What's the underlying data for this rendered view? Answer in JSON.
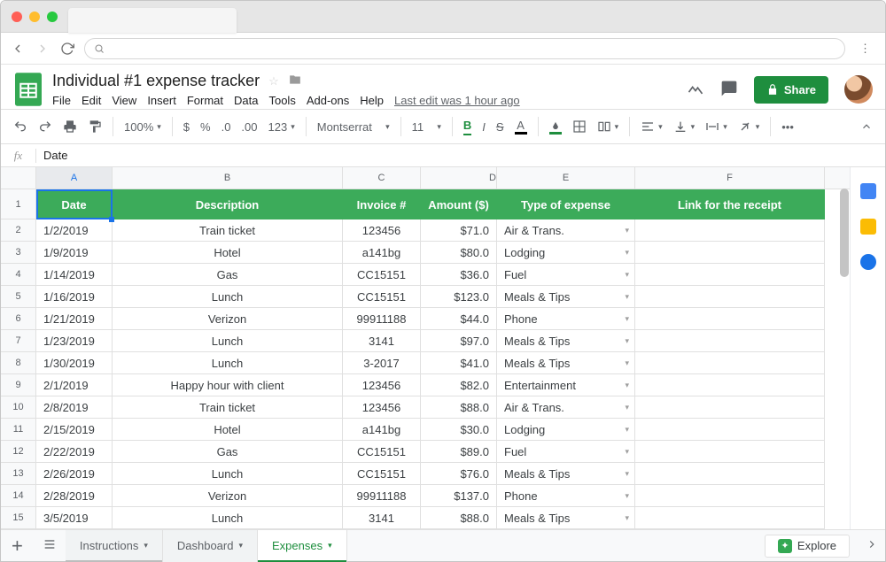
{
  "doc": {
    "title": "Individual #1 expense tracker",
    "last_edit": "Last edit was 1 hour ago"
  },
  "menus": [
    "File",
    "Edit",
    "View",
    "Insert",
    "Format",
    "Data",
    "Tools",
    "Add-ons",
    "Help"
  ],
  "share_label": "Share",
  "toolbar": {
    "zoom": "100%",
    "currency": "$",
    "percent": "%",
    "dec_dec": ".0",
    "inc_dec": ".00",
    "numfmt": "123",
    "font": "Montserrat",
    "size": "11",
    "bold": "B",
    "italic": "I",
    "strike": "S",
    "textA": "A"
  },
  "fx": {
    "value": "Date"
  },
  "columns": [
    "A",
    "B",
    "C",
    "D",
    "E",
    "F"
  ],
  "headers": {
    "date": "Date",
    "desc": "Description",
    "invoice": "Invoice #",
    "amount": "Amount ($)",
    "type": "Type of expense",
    "link": "Link for the receipt"
  },
  "rows": [
    {
      "n": 2,
      "date": "1/2/2019",
      "desc": "Train ticket",
      "inv": "123456",
      "amt": "$71.0",
      "type": "Air & Trans."
    },
    {
      "n": 3,
      "date": "1/9/2019",
      "desc": "Hotel",
      "inv": "a141bg",
      "amt": "$80.0",
      "type": "Lodging"
    },
    {
      "n": 4,
      "date": "1/14/2019",
      "desc": "Gas",
      "inv": "CC15151",
      "amt": "$36.0",
      "type": "Fuel"
    },
    {
      "n": 5,
      "date": "1/16/2019",
      "desc": "Lunch",
      "inv": "CC15151",
      "amt": "$123.0",
      "type": "Meals & Tips"
    },
    {
      "n": 6,
      "date": "1/21/2019",
      "desc": "Verizon",
      "inv": "99911188",
      "amt": "$44.0",
      "type": "Phone"
    },
    {
      "n": 7,
      "date": "1/23/2019",
      "desc": "Lunch",
      "inv": "3141",
      "amt": "$97.0",
      "type": "Meals & Tips"
    },
    {
      "n": 8,
      "date": "1/30/2019",
      "desc": "Lunch",
      "inv": "3-2017",
      "amt": "$41.0",
      "type": "Meals & Tips"
    },
    {
      "n": 9,
      "date": "2/1/2019",
      "desc": "Happy hour with client",
      "inv": "123456",
      "amt": "$82.0",
      "type": "Entertainment"
    },
    {
      "n": 10,
      "date": "2/8/2019",
      "desc": "Train ticket",
      "inv": "123456",
      "amt": "$88.0",
      "type": "Air & Trans."
    },
    {
      "n": 11,
      "date": "2/15/2019",
      "desc": "Hotel",
      "inv": "a141bg",
      "amt": "$30.0",
      "type": "Lodging"
    },
    {
      "n": 12,
      "date": "2/22/2019",
      "desc": "Gas",
      "inv": "CC15151",
      "amt": "$89.0",
      "type": "Fuel"
    },
    {
      "n": 13,
      "date": "2/26/2019",
      "desc": "Lunch",
      "inv": "CC15151",
      "amt": "$76.0",
      "type": "Meals & Tips"
    },
    {
      "n": 14,
      "date": "2/28/2019",
      "desc": "Verizon",
      "inv": "99911188",
      "amt": "$137.0",
      "type": "Phone"
    },
    {
      "n": 15,
      "date": "3/5/2019",
      "desc": "Lunch",
      "inv": "3141",
      "amt": "$88.0",
      "type": "Meals & Tips"
    }
  ],
  "tabs": [
    {
      "label": "Instructions",
      "active": false
    },
    {
      "label": "Dashboard",
      "active": false
    },
    {
      "label": "Expenses",
      "active": true
    }
  ],
  "explore": "Explore"
}
